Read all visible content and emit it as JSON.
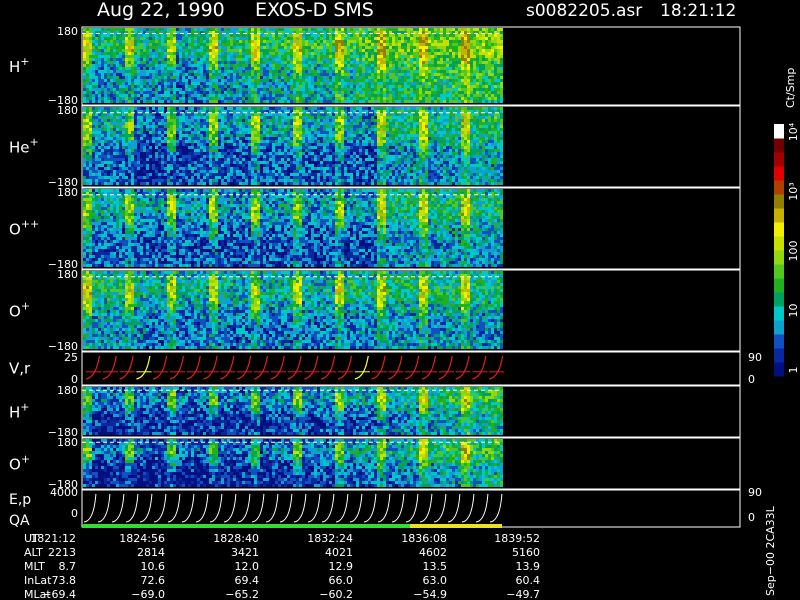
{
  "header": {
    "date": "Aug 22, 1990",
    "instrument": "EXOS-D SMS",
    "file": "s0082205.asr",
    "time": "18:21:12"
  },
  "colors": {
    "background": "#000000",
    "frame": "#ffffff",
    "dashed_line": "#ffffff",
    "red_trace": "#e0201a",
    "yellow_trace": "#ffff40",
    "qa_good": "#30e030",
    "qa_warn": "#f0e020"
  },
  "colorbar": {
    "unit": "Ct/Smp",
    "tick_labels": [
      "1",
      "10",
      "100",
      "10³",
      "10⁴"
    ],
    "colors": [
      "#001080",
      "#0828a0",
      "#1050c0",
      "#10a0d0",
      "#00c8c8",
      "#00a060",
      "#20b020",
      "#50c820",
      "#90d810",
      "#c8e000",
      "#f0f000",
      "#c8b000",
      "#908000",
      "#b04000",
      "#e00000",
      "#a00000",
      "#700000",
      "#ffffff"
    ]
  },
  "chart_data": [
    {
      "type": "heatmap",
      "panel": "H+ pitch-angle spectrogram",
      "ylabel": "H+",
      "yticks": [
        "180",
        "−180"
      ],
      "ylim": [
        -180,
        180
      ],
      "x_label_series": "UT",
      "activity_profile": [
        0.55,
        0.6,
        0.6,
        0.55,
        0.5,
        0.55,
        0.6,
        0.65,
        0.65,
        0.7,
        0.7,
        0.7,
        0.75,
        0.8,
        0.85,
        0.85,
        0.9,
        0.9,
        0.95,
        0.95
      ],
      "dashed_at": 150
    },
    {
      "type": "heatmap",
      "panel": "He+ pitch-angle spectrogram",
      "ylabel": "He+",
      "yticks": [
        "180",
        "−180"
      ],
      "ylim": [
        -180,
        180
      ],
      "activity_profile": [
        0.45,
        0.5,
        0.3,
        0.3,
        0.35,
        0.4,
        0.4,
        0.4,
        0.45,
        0.45,
        0.45,
        0.45,
        0.4,
        0.4,
        0.55,
        0.6,
        0.6,
        0.6,
        0.65,
        0.65
      ],
      "dashed_at": 150
    },
    {
      "type": "heatmap",
      "panel": "O++ pitch-angle spectrogram",
      "ylabel": "O++",
      "yticks": [
        "180",
        "−180"
      ],
      "ylim": [
        -180,
        180
      ],
      "activity_profile": [
        0.45,
        0.45,
        0.4,
        0.4,
        0.4,
        0.4,
        0.4,
        0.4,
        0.4,
        0.4,
        0.4,
        0.4,
        0.4,
        0.4,
        0.55,
        0.6,
        0.6,
        0.6,
        0.6,
        0.6
      ],
      "dashed_at": 150
    },
    {
      "type": "heatmap",
      "panel": "O+ pitch-angle spectrogram",
      "ylabel": "O+",
      "yticks": [
        "180",
        "−180"
      ],
      "ylim": [
        -180,
        180
      ],
      "activity_profile": [
        0.6,
        0.6,
        0.55,
        0.5,
        0.5,
        0.5,
        0.5,
        0.5,
        0.5,
        0.5,
        0.5,
        0.5,
        0.55,
        0.55,
        0.6,
        0.6,
        0.6,
        0.6,
        0.6,
        0.6
      ],
      "dashed_at": 150
    },
    {
      "type": "line",
      "panel": "V, r",
      "ylabel": "V,r",
      "yticks_left": [
        "25",
        "0"
      ],
      "yticks_right": [
        "90",
        "0"
      ],
      "ylim": [
        0,
        25
      ],
      "sweeps": 25
    },
    {
      "type": "heatmap",
      "panel": "H+ (second)",
      "ylabel": "H+",
      "yticks": [
        "180",
        "−180"
      ],
      "ylim": [
        -180,
        180
      ],
      "activity_profile": [
        0.3,
        0.3,
        0.3,
        0.3,
        0.3,
        0.3,
        0.3,
        0.3,
        0.3,
        0.35,
        0.35,
        0.4,
        0.4,
        0.45,
        0.5,
        0.55,
        0.6,
        0.65,
        0.7,
        0.75
      ],
      "dashed_at": 150
    },
    {
      "type": "heatmap",
      "panel": "O+ (second)",
      "ylabel": "O+",
      "yticks": [
        "180",
        "−180"
      ],
      "ylim": [
        -180,
        180
      ],
      "activity_profile": [
        0.25,
        0.25,
        0.25,
        0.25,
        0.25,
        0.25,
        0.25,
        0.25,
        0.25,
        0.3,
        0.3,
        0.35,
        0.4,
        0.45,
        0.5,
        0.55,
        0.6,
        0.65,
        0.7,
        0.75
      ],
      "dashed_at": 150
    },
    {
      "type": "line",
      "panel": "E, p / QA",
      "ylabel_top": "E,p",
      "ylabel_bottom": "QA",
      "yticks_left": [
        "4000",
        "0"
      ],
      "yticks_right": [
        "90",
        "0"
      ],
      "ylim": [
        0,
        4000
      ],
      "sweeps": 30
    }
  ],
  "ephemeris": {
    "rows": [
      {
        "label": "UT",
        "values": [
          "1821:12",
          "1824:56",
          "1828:40",
          "1832:24",
          "1836:08",
          "1839:52"
        ]
      },
      {
        "label": "ALT",
        "values": [
          "2213",
          "2814",
          "3421",
          "4021",
          "4602",
          "5160"
        ]
      },
      {
        "label": "MLT",
        "values": [
          "8.7",
          "10.6",
          "12.0",
          "12.9",
          "13.5",
          "13.9"
        ]
      },
      {
        "label": "InLat",
        "values": [
          "73.8",
          "72.6",
          "69.4",
          "66.0",
          "63.0",
          "60.4"
        ]
      },
      {
        "label": "MLat",
        "values": [
          "−69.4",
          "−69.0",
          "−65.2",
          "−60.2",
          "−54.9",
          "−49.7"
        ]
      }
    ]
  },
  "footer": {
    "side_text": "Sep−00  2CA33L"
  }
}
